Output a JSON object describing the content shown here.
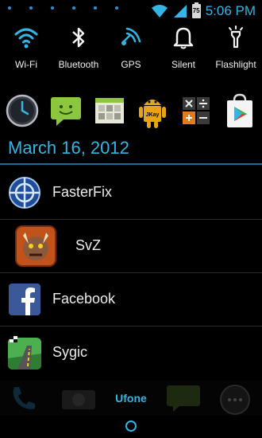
{
  "status_bar": {
    "time": "5:06 PM",
    "battery_level": "75",
    "notification_dot_count": 6,
    "accent_color": "#33b5e5"
  },
  "toggles": [
    {
      "label": "Wi-Fi",
      "icon": "wifi-icon"
    },
    {
      "label": "Bluetooth",
      "icon": "bluetooth-icon"
    },
    {
      "label": "GPS",
      "icon": "gps-icon"
    },
    {
      "label": "Silent",
      "icon": "bell-icon"
    },
    {
      "label": "Flashlight",
      "icon": "flashlight-icon"
    }
  ],
  "apps": [
    {
      "icon": "clock-icon"
    },
    {
      "icon": "messaging-icon"
    },
    {
      "icon": "gallery-icon"
    },
    {
      "icon": "android-jkay-icon",
      "badge": "JKay"
    },
    {
      "icon": "calculator-icon"
    },
    {
      "icon": "play-store-icon"
    }
  ],
  "date": "March 16, 2012",
  "notifications": [
    {
      "title": "FasterFix",
      "icon": "fasterfix-icon"
    },
    {
      "title": "SvZ",
      "icon": "svz-game-icon"
    },
    {
      "title": "Facebook",
      "icon": "facebook-icon"
    },
    {
      "title": "Sygic",
      "icon": "sygic-icon"
    }
  ],
  "carrier": "Ufone"
}
